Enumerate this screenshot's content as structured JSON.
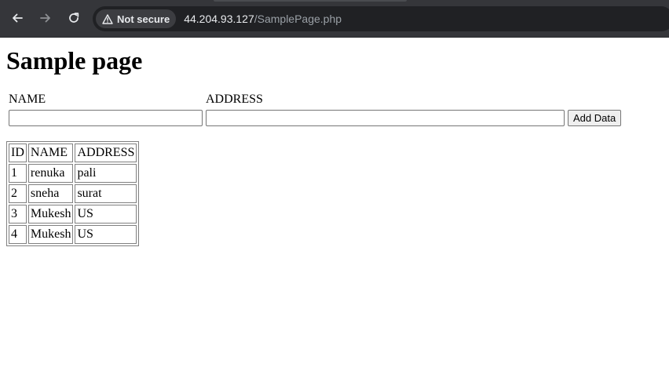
{
  "browser": {
    "security_label": "Not secure",
    "url_host": "44.204.93.127",
    "url_path": "/SamplePage.php",
    "icons": {
      "back": "arrow-left-icon",
      "forward": "arrow-right-icon",
      "reload": "reload-icon",
      "security": "warning-triangle-icon"
    }
  },
  "page": {
    "title": "Sample page"
  },
  "form": {
    "name_label": "NAME",
    "address_label": "ADDRESS",
    "name_value": "",
    "address_value": "",
    "submit_label": "Add Data"
  },
  "table": {
    "headers": [
      "ID",
      "NAME",
      "ADDRESS"
    ],
    "rows": [
      [
        "1",
        "renuka",
        "pali"
      ],
      [
        "2",
        "sneha",
        "surat"
      ],
      [
        "3",
        "Mukesh",
        "US"
      ],
      [
        "4",
        "Mukesh",
        "US"
      ]
    ]
  },
  "colors": {
    "toolbar_bg": "#35363a",
    "omnibox_bg": "#202124",
    "url_host": "#e8eaed",
    "url_path": "#9aa0a6"
  }
}
